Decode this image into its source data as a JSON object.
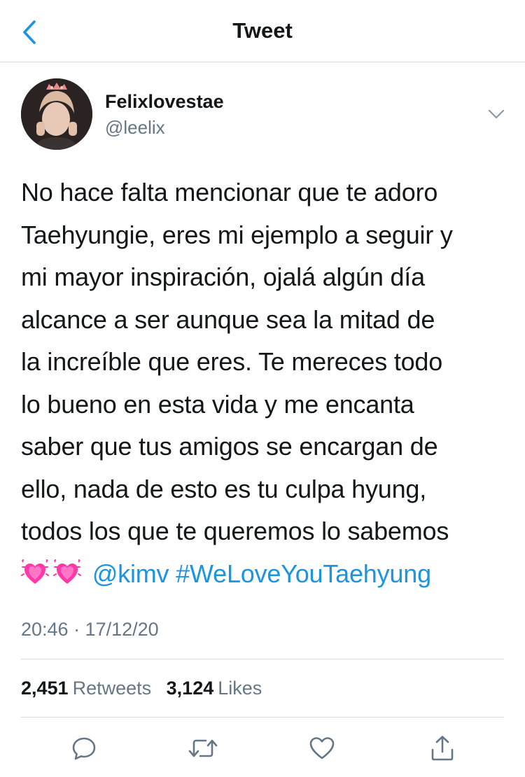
{
  "header": {
    "title": "Tweet",
    "back_icon": "chevron-left-icon"
  },
  "author": {
    "display_name": "Felixlovestae",
    "handle": "@leelix",
    "more_icon": "chevron-down-icon"
  },
  "tweet": {
    "lines": [
      "No hace falta mencionar que te adoro",
      "Taehyungie, eres mi ejemplo a seguir y",
      "mi mayor inspiración, ojalá algún día",
      "alcance a ser aunque sea la mitad de",
      "la increíble que eres. Te mereces todo",
      "lo bueno en esta vida y me encanta",
      "saber que tus amigos se encargan de",
      "ello, nada de esto es tu culpa hyung,",
      "todos los que te queremos lo sabemos"
    ],
    "emojis": [
      "growing-heart-emoji",
      "growing-heart-emoji"
    ],
    "mention": "@kimv",
    "hashtag": "#WeLoveYouTaehyung",
    "timestamp": "20:46 · 17/12/20"
  },
  "stats": {
    "retweets_count": "2,451",
    "retweets_label": "Retweets",
    "likes_count": "3,124",
    "likes_label": "Likes"
  },
  "actions": {
    "reply_icon": "reply-icon",
    "retweet_icon": "retweet-icon",
    "like_icon": "heart-icon",
    "share_icon": "share-icon"
  },
  "colors": {
    "accent": "#1b95e0",
    "text_primary": "#14171a",
    "text_secondary": "#657786",
    "divider": "#d9dde1",
    "emoji_heart": "#ff3aa8"
  }
}
